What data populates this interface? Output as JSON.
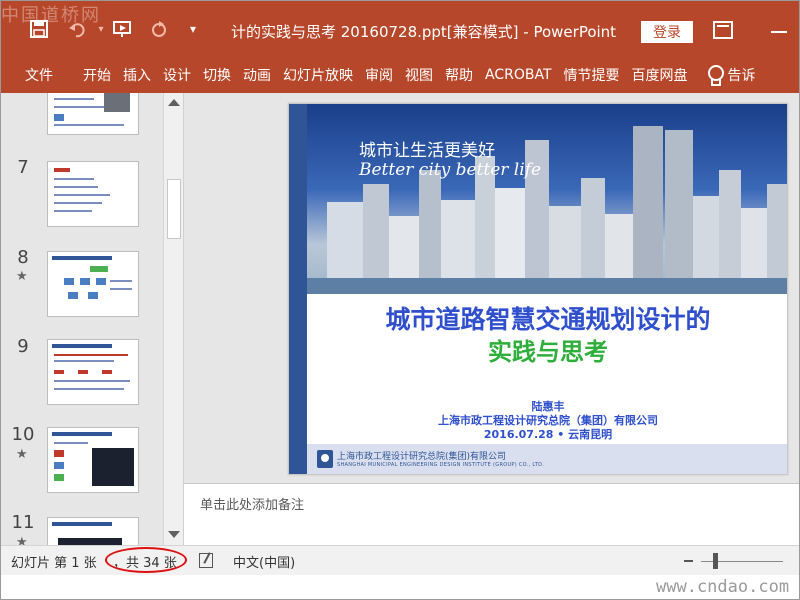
{
  "app": {
    "document_title": "计的实践与思考 20160728.ppt[兼容模式]  -  PowerPoint",
    "login_label": "登录",
    "watermark_top": "中国道桥网",
    "watermark_bottom": "www.cndao.com"
  },
  "ribbon": {
    "tabs": [
      "文件",
      "开始",
      "插入",
      "设计",
      "切换",
      "动画",
      "幻灯片放映",
      "审阅",
      "视图",
      "帮助",
      "ACROBAT",
      "情节提要",
      "百度网盘"
    ],
    "tell_me": "告诉"
  },
  "thumbnails": [
    {
      "number": "",
      "star": false
    },
    {
      "number": "7",
      "star": false
    },
    {
      "number": "8",
      "star": true
    },
    {
      "number": "9",
      "star": false
    },
    {
      "number": "10",
      "star": true
    },
    {
      "number": "11",
      "star": true
    }
  ],
  "slide": {
    "slogan_cn": "城市让生活更美好",
    "slogan_en": "Better city better life",
    "title_line1": "城市道路智慧交通规划设计的",
    "title_line2": "实践与思考",
    "author": "陆惠丰",
    "organization": "上海市政工程设计研究总院（集团）有限公司",
    "date_place": "2016.07.28 • 云南昆明",
    "footer_cn": "上海市政工程设计研究总院(集团)有限公司",
    "footer_en": "SHANGHAI MUNICIPAL ENGINEERING DESIGN INSTITUTE (GROUP) CO., LTD.",
    "colors": {
      "title_blue": "#2f4fcc",
      "title_green": "#2eae3a",
      "accent": "#2f5597"
    }
  },
  "notes": {
    "placeholder": "单击此处添加备注"
  },
  "status": {
    "slide_position": "幻灯片 第 1 张",
    "slide_count": "，共 34 张",
    "language": "中文(中国)"
  },
  "theme": {
    "ribbon_color": "#b7472a",
    "highlight_ellipse": "#dd1111"
  }
}
